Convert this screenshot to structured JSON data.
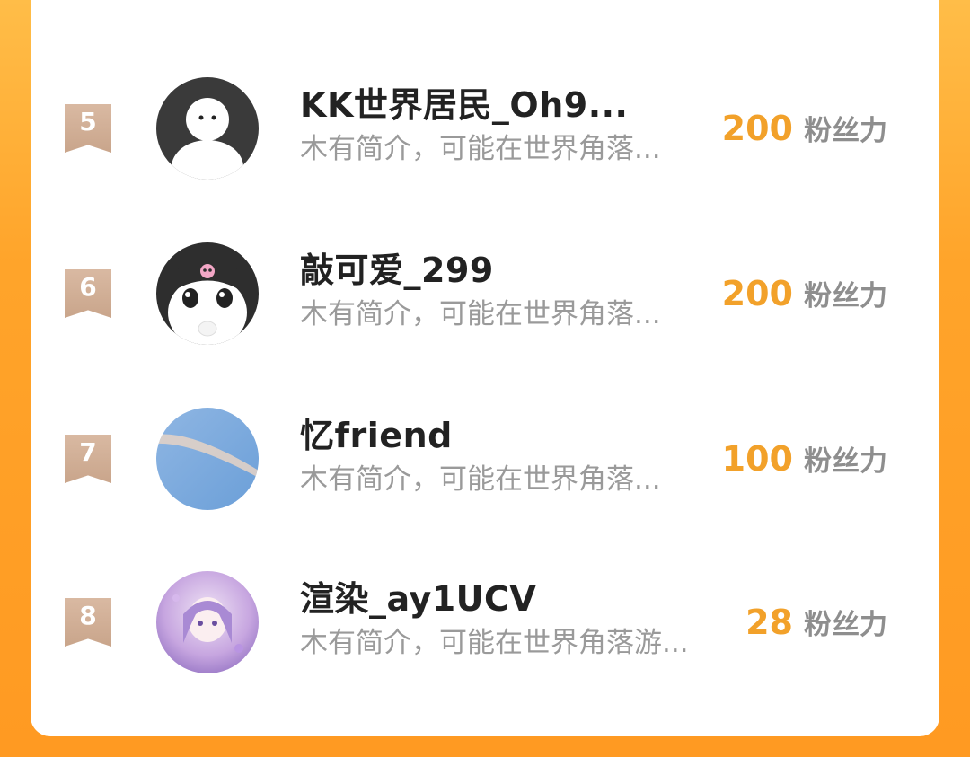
{
  "fans_unit": "粉丝力",
  "colors": {
    "accent": "#f2a12a",
    "background": "#ff9a22",
    "rank_badge": "#ccaa90",
    "name": "#222222",
    "bio": "#9a9a9a"
  },
  "ranking": [
    {
      "rank": "5",
      "name": "KK世界居民_Oh9...",
      "bio": "木有简介，可能在世界角落...",
      "fans": "200",
      "avatar": "white-figure-avatar"
    },
    {
      "rank": "6",
      "name": "敲可爱_299",
      "bio": "木有简介，可能在世界角落...",
      "fans": "200",
      "avatar": "kuromi-avatar"
    },
    {
      "rank": "7",
      "name": "忆friend",
      "bio": "木有简介，可能在世界角落...",
      "fans": "100",
      "avatar": "sky-avatar"
    },
    {
      "rank": "8",
      "name": "渲染_ay1UCV",
      "bio": "木有简介，可能在世界角落游...",
      "fans": "28",
      "avatar": "anime-girl-avatar"
    }
  ]
}
